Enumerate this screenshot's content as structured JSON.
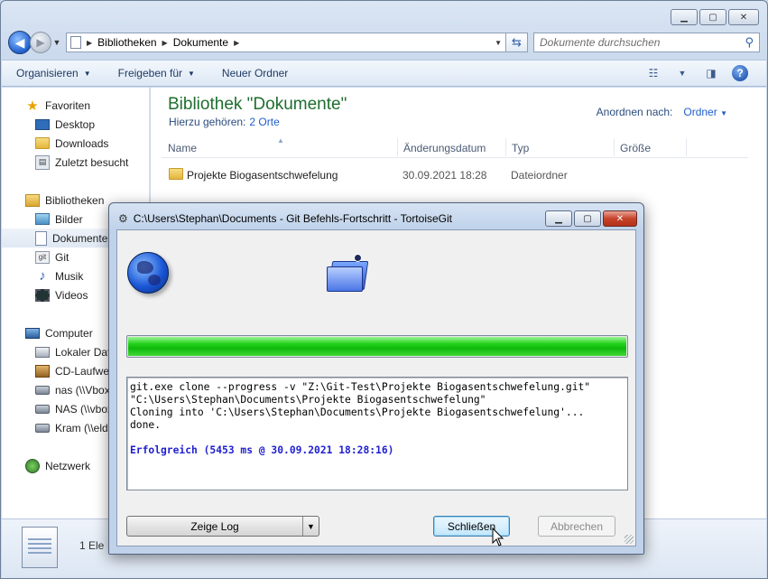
{
  "explorer": {
    "caption_buttons": {
      "minimize": "▁",
      "maximize": "▢",
      "close": "✕"
    },
    "address": {
      "crumbs": [
        "Bibliotheken",
        "Dokumente"
      ],
      "search_placeholder": "Dokumente durchsuchen"
    },
    "toolbar": {
      "organize": "Organisieren",
      "share": "Freigeben für",
      "new_folder": "Neuer Ordner"
    },
    "nav": {
      "favorites": "Favoriten",
      "desktop": "Desktop",
      "downloads": "Downloads",
      "recent": "Zuletzt besucht",
      "libraries": "Bibliotheken",
      "pictures": "Bilder",
      "documents": "Dokumente",
      "git": "Git",
      "music": "Musik",
      "videos": "Videos",
      "computer": "Computer",
      "local_disk": "Lokaler Datenträger",
      "cd_drive": "CD-Laufwerk",
      "nas1": "nas (\\\\Vbox",
      "nas2": "NAS (\\\\vbox",
      "kram": "Kram (\\\\eldo",
      "network": "Netzwerk"
    },
    "library": {
      "title": "Bibliothek \"Dokumente\"",
      "includes_label": "Hierzu gehören:",
      "includes_link": "2 Orte",
      "arrange_label": "Anordnen nach:",
      "arrange_value": "Ordner"
    },
    "columns": {
      "name": "Name",
      "date": "Änderungsdatum",
      "type": "Typ",
      "size": "Größe"
    },
    "files": [
      {
        "name": "Projekte Biogasentschwefelung",
        "date": "30.09.2021 18:28",
        "type": "Dateiordner"
      }
    ],
    "status": "1 Ele"
  },
  "dialog": {
    "title": "C:\\Users\\Stephan\\Documents - Git Befehls-Fortschritt - TortoiseGit",
    "progress": 1.0,
    "log": {
      "line1": "git.exe clone --progress -v \"Z:\\Git-Test\\Projekte Biogasentschwefelung.git\"",
      "line2": "\"C:\\Users\\Stephan\\Documents\\Projekte Biogasentschwefelung\"",
      "line3": "Cloning into 'C:\\Users\\Stephan\\Documents\\Projekte Biogasentschwefelung'...",
      "line4": "done.",
      "success": "Erfolgreich (5453 ms @ 30.09.2021 18:28:16)"
    },
    "buttons": {
      "show_log": "Zeige Log",
      "close": "Schließen",
      "abort": "Abbrechen"
    },
    "colors": {
      "progress": "#18c414",
      "success_text": "#1f1fd1"
    }
  }
}
